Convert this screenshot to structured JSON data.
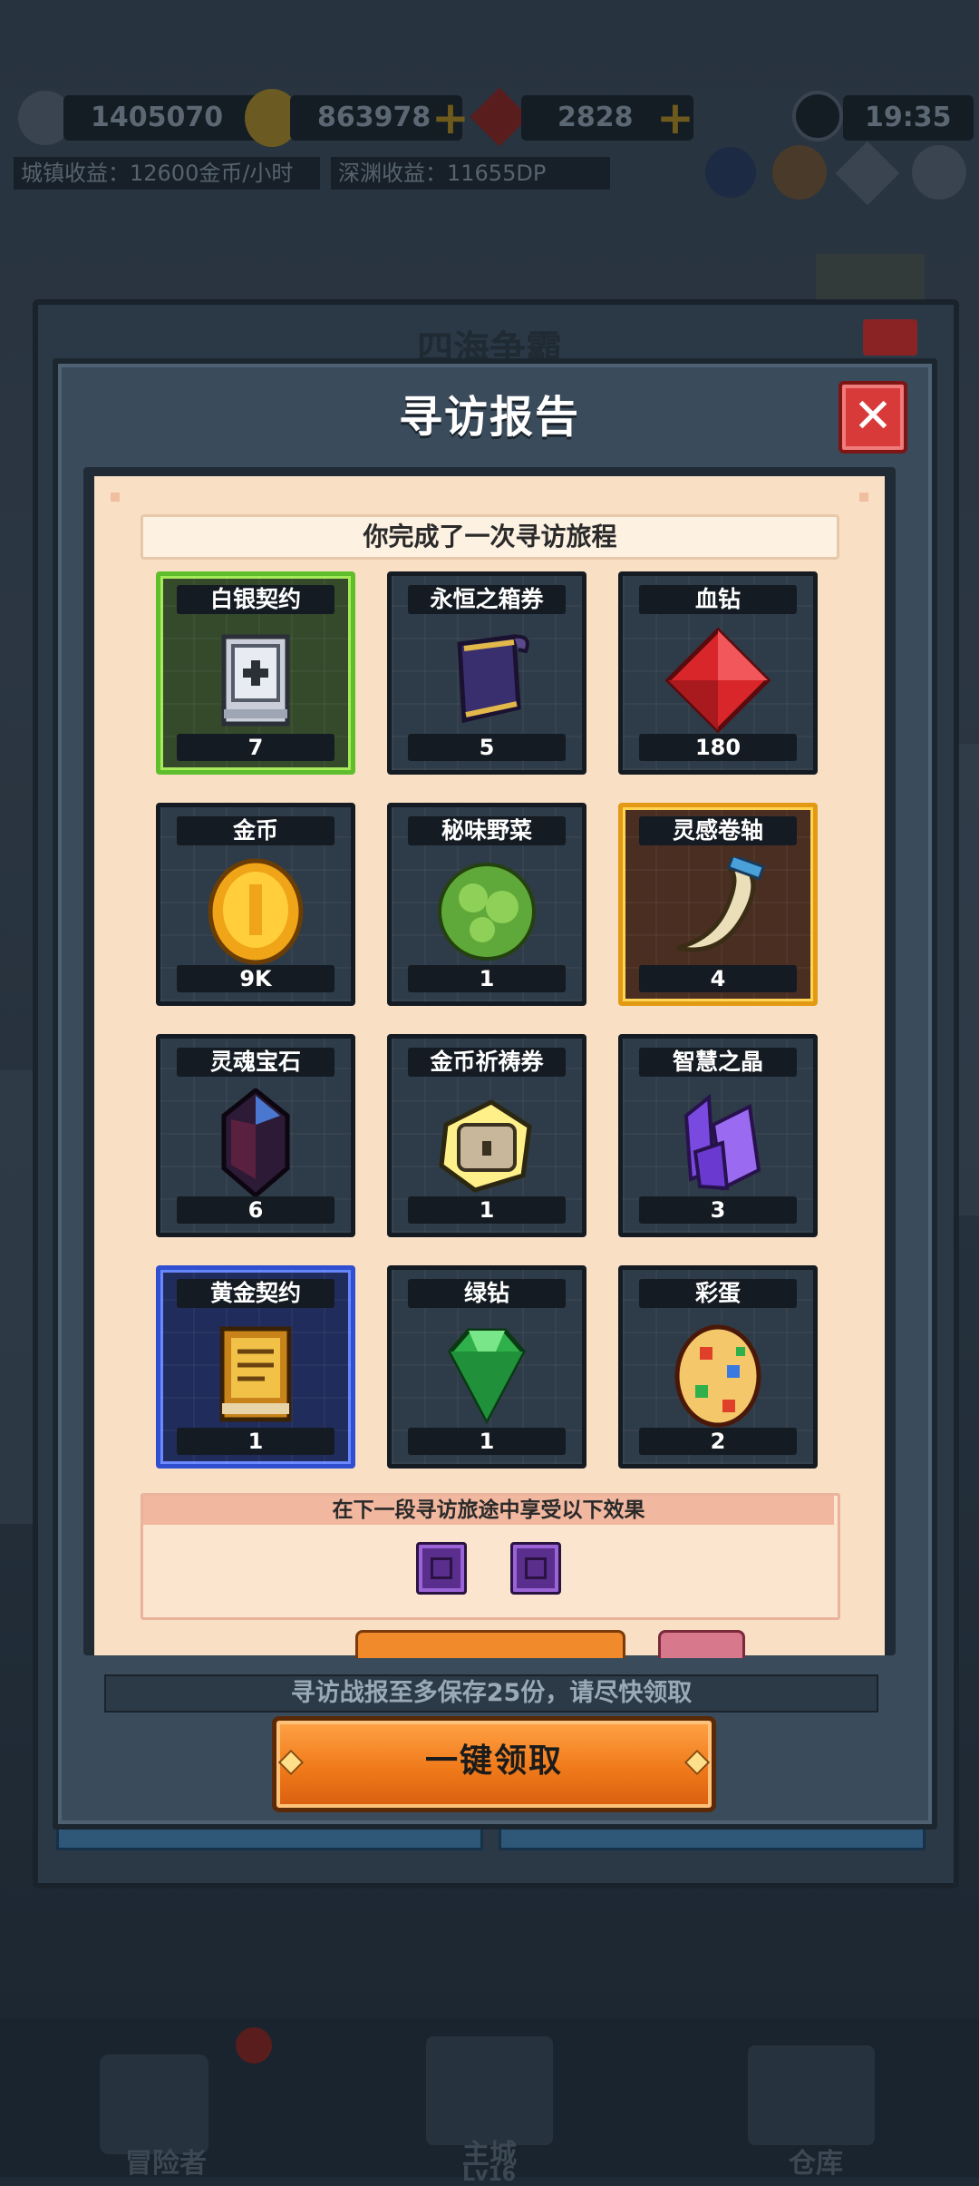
{
  "hud": {
    "power": "1405070",
    "gold": "863978",
    "gems": "2828",
    "time": "19:35",
    "town_income": "城镇收益：12600金币/小时",
    "abyss_income": "深渊收益：11655DP"
  },
  "background": {
    "behind_title": "四海争霸"
  },
  "dialog": {
    "title": "寻访报告",
    "close_icon": "close-x",
    "subtitle": "你完成了一次寻访旅程",
    "items": [
      {
        "name": "白银契约",
        "count": "7",
        "rarity": "green",
        "icon": "silver-contract-book"
      },
      {
        "name": "永恒之箱券",
        "count": "5",
        "rarity": "normal",
        "icon": "eternal-chest-ticket"
      },
      {
        "name": "血钻",
        "count": "180",
        "rarity": "normal",
        "icon": "blood-diamond"
      },
      {
        "name": "金币",
        "count": "9K",
        "rarity": "normal",
        "icon": "gold-coin"
      },
      {
        "name": "秘味野菜",
        "count": "1",
        "rarity": "normal",
        "icon": "wild-herb"
      },
      {
        "name": "灵感卷轴",
        "count": "4",
        "rarity": "gold",
        "icon": "inspiration-scroll"
      },
      {
        "name": "灵魂宝石",
        "count": "6",
        "rarity": "normal",
        "icon": "soul-gem"
      },
      {
        "name": "金币祈祷券",
        "count": "1",
        "rarity": "normal",
        "icon": "gold-prayer-ticket"
      },
      {
        "name": "智慧之晶",
        "count": "3",
        "rarity": "normal",
        "icon": "wisdom-crystal"
      },
      {
        "name": "黄金契约",
        "count": "1",
        "rarity": "blue",
        "icon": "gold-contract-book"
      },
      {
        "name": "绿钻",
        "count": "1",
        "rarity": "normal",
        "icon": "green-diamond"
      },
      {
        "name": "彩蛋",
        "count": "2",
        "rarity": "normal",
        "icon": "easter-egg"
      }
    ],
    "effects_title": "在下一段寻访旅途中享受以下效果",
    "effect_icons": [
      "purple-effect-icon",
      "purple-effect-icon"
    ],
    "notice": "寻访战报至多保存25份，请尽快领取",
    "claim_label": "一键领取"
  },
  "nav": {
    "adventurer": "冒险者",
    "main_city": "主城",
    "main_city_level": "Lv16",
    "warehouse": "仓库"
  },
  "colors": {
    "rarity_green": "#5fbe2b",
    "rarity_gold": "#e29a15",
    "rarity_blue": "#2f4fd0",
    "claim_orange": "#f07a1a",
    "close_red": "#d83a3a"
  }
}
